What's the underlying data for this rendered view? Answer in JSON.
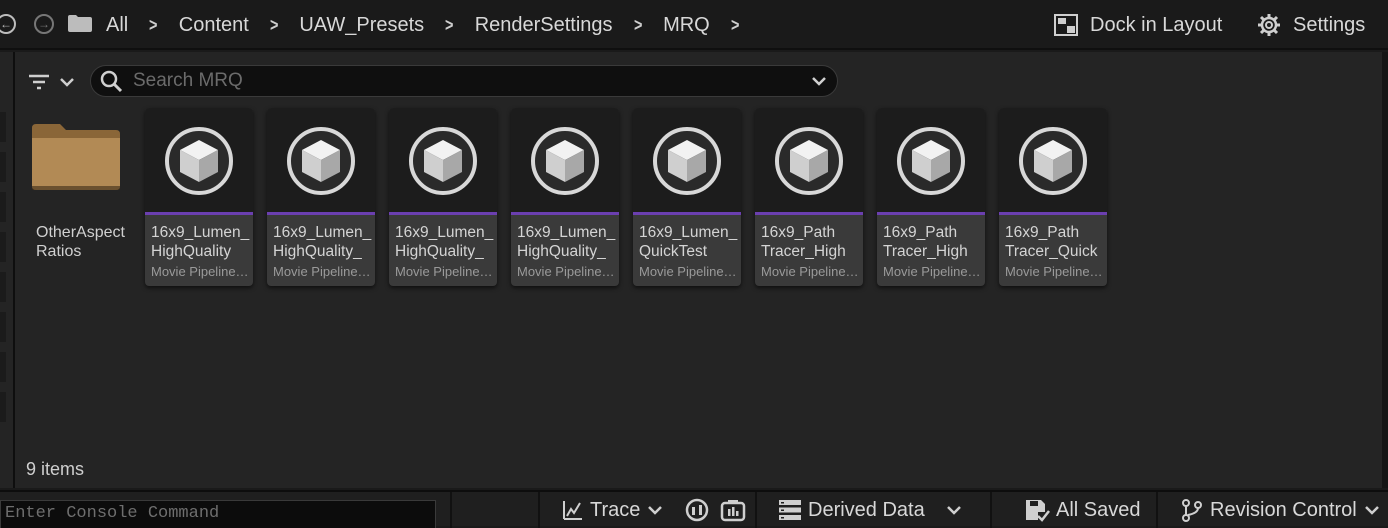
{
  "nav": {
    "back_icon": "back-arrow-icon",
    "forward_icon": "forward-arrow-icon",
    "folder_icon": "folder-icon"
  },
  "breadcrumbs": [
    "All",
    "Content",
    "UAW_Presets",
    "RenderSettings",
    "MRQ"
  ],
  "toolbar": {
    "dock_label": "Dock in Layout",
    "settings_label": "Settings"
  },
  "search": {
    "placeholder": "Search MRQ",
    "value": ""
  },
  "folders": [
    {
      "name": "OtherAspect\nRatios"
    }
  ],
  "assets": [
    {
      "name": "16x9_Lumen_\nHighQuality",
      "type": "Movie Pipeline Primary Config"
    },
    {
      "name": "16x9_Lumen_\nHighQuality_",
      "type": "Movie Pipeline Primary Config"
    },
    {
      "name": "16x9_Lumen_\nHighQuality_",
      "type": "Movie Pipeline Primary Config"
    },
    {
      "name": "16x9_Lumen_\nHighQuality_",
      "type": "Movie Pipeline Primary Config"
    },
    {
      "name": "16x9_Lumen_\nQuickTest",
      "type": "Movie Pipeline Primary Config"
    },
    {
      "name": "16x9_Path\nTracer_High",
      "type": "Movie Pipeline Primary Config"
    },
    {
      "name": "16x9_Path\nTracer_High",
      "type": "Movie Pipeline Primary Config"
    },
    {
      "name": "16x9_Path\nTracer_Quick",
      "type": "Movie Pipeline Primary Config"
    }
  ],
  "item_count": "9 items",
  "statusbar": {
    "console_placeholder": "Enter Console Command",
    "trace_label": "Trace",
    "derived_data_label": "Derived Data",
    "saved_label": "All Saved",
    "revision_label": "Revision Control"
  },
  "colors": {
    "asset_bar": "#6b3fb0",
    "folder": "#b28a55",
    "background": "#242424"
  }
}
